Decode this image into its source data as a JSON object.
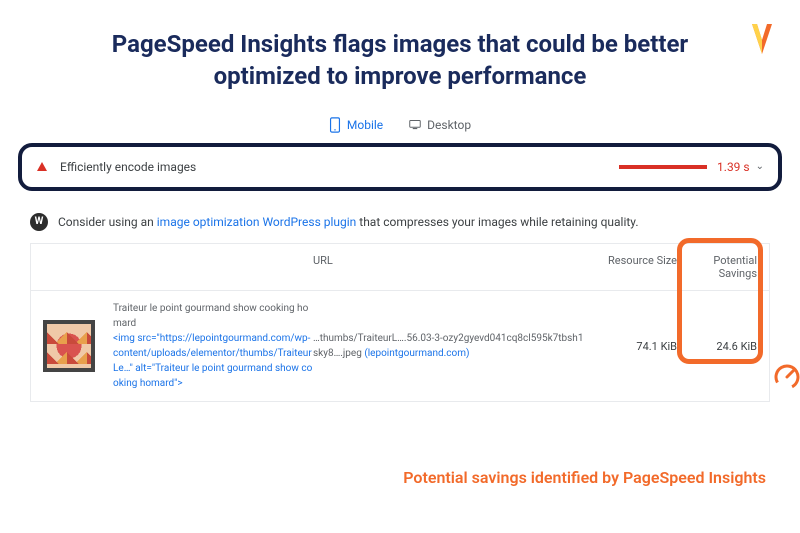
{
  "title": "PageSpeed Insights flags images that could be better optimized to improve performance",
  "tabs": {
    "mobile": "Mobile",
    "desktop": "Desktop"
  },
  "audit": {
    "label": "Efficiently encode images",
    "time": "1.39 s"
  },
  "recommendation": {
    "prefix": "Consider using an ",
    "link": "image optimization WordPress plugin",
    "suffix": " that compresses your images while retaining quality."
  },
  "table": {
    "headers": {
      "url": "URL",
      "size": "Resource Size",
      "savings_line1": "Potential",
      "savings_line2": "Savings"
    },
    "row": {
      "alt": "Traiteur le point gourmand show cooking homard",
      "img_open": "<img src=\"",
      "src_url": "https://lepointgourmand.com/wp-content/uploads/elementor/thumbs/TraiteurLe…",
      "img_close": "\" alt=\"Traiteur le point gourmand show cooking homard\">",
      "url_text": "…thumbs/TraiteurL….56.03-3-ozy2gyevd041cq8cl595k7tbsh1sky8….jpeg",
      "domain": "(lepointgourmand.com)",
      "size": "74.1 KiB",
      "savings": "24.6 KiB"
    }
  },
  "annotation": "Potential savings identified by PageSpeed Insights"
}
